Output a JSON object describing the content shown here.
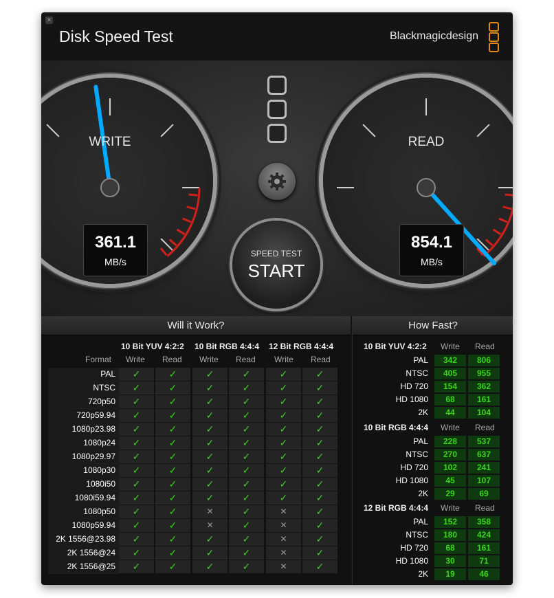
{
  "window": {
    "title": "Disk Speed Test",
    "brand": "Blackmagicdesign",
    "close_glyph": "×"
  },
  "gauges": {
    "write": {
      "label": "WRITE",
      "value": "361.1",
      "unit": "MB/s"
    },
    "read": {
      "label": "READ",
      "value": "854.1",
      "unit": "MB/s"
    }
  },
  "start_button": {
    "sub": "SPEED TEST",
    "main": "START"
  },
  "icons": {
    "settings": "gear-icon",
    "close": "close-icon",
    "logo": "blackmagic-logo-icon"
  },
  "colors": {
    "accent": "#00aaff",
    "ok": "#3ad51c",
    "brand": "#e08a1a",
    "redline": "#d0201a"
  },
  "will_it_work": {
    "title": "Will it Work?",
    "format_header": "Format",
    "groups": [
      "10 Bit YUV 4:2:2",
      "10 Bit RGB 4:4:4",
      "12 Bit RGB 4:4:4"
    ],
    "col_headers": [
      "Write",
      "Read"
    ],
    "check_glyph": "✓",
    "cross_glyph": "✕",
    "rows": [
      {
        "format": "PAL",
        "checks": [
          1,
          1,
          1,
          1,
          1,
          1
        ]
      },
      {
        "format": "NTSC",
        "checks": [
          1,
          1,
          1,
          1,
          1,
          1
        ]
      },
      {
        "format": "720p50",
        "checks": [
          1,
          1,
          1,
          1,
          1,
          1
        ]
      },
      {
        "format": "720p59.94",
        "checks": [
          1,
          1,
          1,
          1,
          1,
          1
        ]
      },
      {
        "format": "1080p23.98",
        "checks": [
          1,
          1,
          1,
          1,
          1,
          1
        ]
      },
      {
        "format": "1080p24",
        "checks": [
          1,
          1,
          1,
          1,
          1,
          1
        ]
      },
      {
        "format": "1080p29.97",
        "checks": [
          1,
          1,
          1,
          1,
          1,
          1
        ]
      },
      {
        "format": "1080p30",
        "checks": [
          1,
          1,
          1,
          1,
          1,
          1
        ]
      },
      {
        "format": "1080i50",
        "checks": [
          1,
          1,
          1,
          1,
          1,
          1
        ]
      },
      {
        "format": "1080i59.94",
        "checks": [
          1,
          1,
          1,
          1,
          1,
          1
        ]
      },
      {
        "format": "1080p50",
        "checks": [
          1,
          1,
          0,
          1,
          0,
          1
        ]
      },
      {
        "format": "1080p59.94",
        "checks": [
          1,
          1,
          0,
          1,
          0,
          1
        ]
      },
      {
        "format": "2K 1556@23.98",
        "checks": [
          1,
          1,
          1,
          1,
          0,
          1
        ]
      },
      {
        "format": "2K 1556@24",
        "checks": [
          1,
          1,
          1,
          1,
          0,
          1
        ]
      },
      {
        "format": "2K 1556@25",
        "checks": [
          1,
          1,
          1,
          1,
          0,
          1
        ]
      }
    ]
  },
  "how_fast": {
    "title": "How Fast?",
    "col_headers": [
      "Write",
      "Read"
    ],
    "groups": [
      {
        "name": "10 Bit YUV 4:2:2",
        "rows": [
          {
            "label": "PAL",
            "write": "342",
            "read": "806"
          },
          {
            "label": "NTSC",
            "write": "405",
            "read": "955"
          },
          {
            "label": "HD 720",
            "write": "154",
            "read": "362"
          },
          {
            "label": "HD 1080",
            "write": "68",
            "read": "161"
          },
          {
            "label": "2K",
            "write": "44",
            "read": "104"
          }
        ]
      },
      {
        "name": "10 Bit RGB 4:4:4",
        "rows": [
          {
            "label": "PAL",
            "write": "228",
            "read": "537"
          },
          {
            "label": "NTSC",
            "write": "270",
            "read": "637"
          },
          {
            "label": "HD 720",
            "write": "102",
            "read": "241"
          },
          {
            "label": "HD 1080",
            "write": "45",
            "read": "107"
          },
          {
            "label": "2K",
            "write": "29",
            "read": "69"
          }
        ]
      },
      {
        "name": "12 Bit RGB 4:4:4",
        "rows": [
          {
            "label": "PAL",
            "write": "152",
            "read": "358"
          },
          {
            "label": "NTSC",
            "write": "180",
            "read": "424"
          },
          {
            "label": "HD 720",
            "write": "68",
            "read": "161"
          },
          {
            "label": "HD 1080",
            "write": "30",
            "read": "71"
          },
          {
            "label": "2K",
            "write": "19",
            "read": "46"
          }
        ]
      }
    ]
  }
}
